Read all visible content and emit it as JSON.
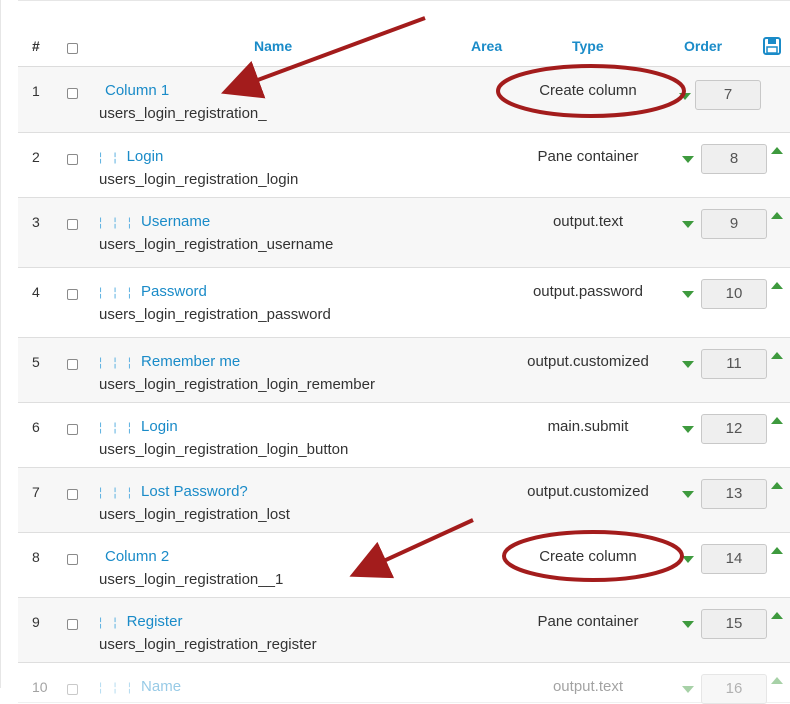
{
  "header": {
    "num": "#",
    "name": "Name",
    "area": "Area",
    "type": "Type",
    "order": "Order"
  },
  "rows": [
    {
      "num": "1",
      "indent": "",
      "label": "Column 1",
      "sub": "users_login_registration_",
      "type": "Create column",
      "order": "7"
    },
    {
      "num": "2",
      "indent": "¦ ¦",
      "label": "Login",
      "sub": "users_login_registration_login",
      "type": "Pane container",
      "order": "8"
    },
    {
      "num": "3",
      "indent": "¦ ¦ ¦",
      "label": "Username",
      "sub": "users_login_registration_username",
      "type": "output.text",
      "order": "9"
    },
    {
      "num": "4",
      "indent": "¦ ¦ ¦",
      "label": "Password",
      "sub": "users_login_registration_password",
      "type": "output.password",
      "order": "10"
    },
    {
      "num": "5",
      "indent": "¦ ¦ ¦",
      "label": "Remember me",
      "sub": "users_login_registration_login_remember",
      "type": "output.customized",
      "order": "11"
    },
    {
      "num": "6",
      "indent": "¦ ¦ ¦",
      "label": "Login",
      "sub": "users_login_registration_login_button",
      "type": "main.submit",
      "order": "12"
    },
    {
      "num": "7",
      "indent": "¦ ¦ ¦",
      "label": "Lost Password?",
      "sub": "users_login_registration_lost",
      "type": "output.customized",
      "order": "13"
    },
    {
      "num": "8",
      "indent": "",
      "label": "Column 2",
      "sub": "users_login_registration__1",
      "type": "Create column",
      "order": "14"
    },
    {
      "num": "9",
      "indent": "¦ ¦",
      "label": "Register",
      "sub": "users_login_registration_register",
      "type": "Pane container",
      "order": "15"
    },
    {
      "num": "10",
      "indent": "¦ ¦ ¦",
      "label": "Name",
      "sub": "",
      "type": "output.text",
      "order": "16"
    }
  ],
  "colors": {
    "link": "#1a8bc8",
    "arrow": "#a31c1c",
    "order_arrows": "#3e9a3e"
  },
  "icons": {
    "save": "floppy-disk-icon",
    "order_up": "triangle-up-icon",
    "order_down": "triangle-down-icon"
  }
}
